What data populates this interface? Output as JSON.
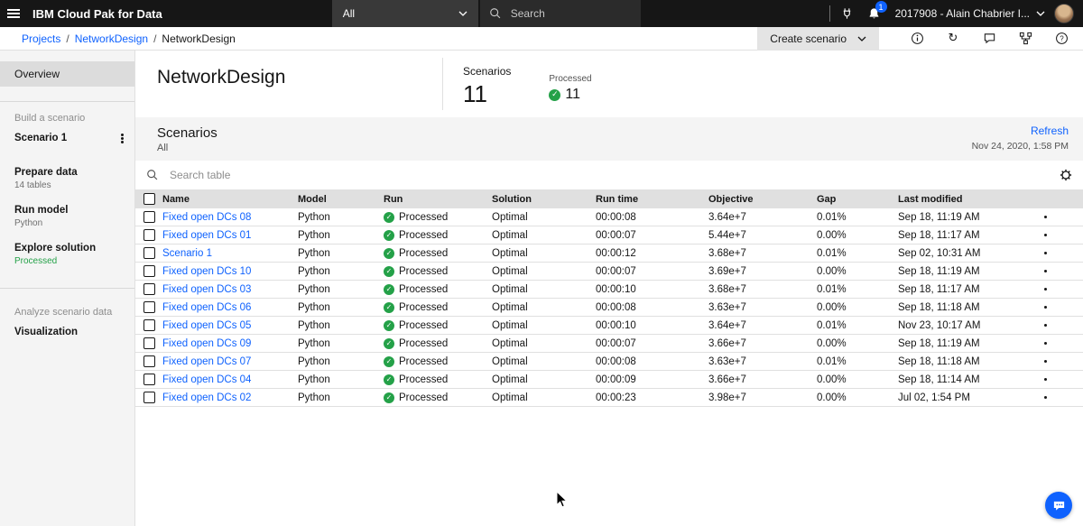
{
  "topbar": {
    "product_title": "IBM Cloud Pak for Data",
    "scope_dropdown": "All",
    "search_placeholder": "Search",
    "notification_badge": "1",
    "account_label": "2017908 - Alain Chabrier I..."
  },
  "breadcrumb": {
    "items": [
      "Projects",
      "NetworkDesign",
      "NetworkDesign"
    ],
    "separator": "/"
  },
  "actions": {
    "create_scenario": "Create scenario"
  },
  "sidebar": {
    "overview": "Overview",
    "build_label": "Build a scenario",
    "scenario": {
      "title": "Scenario 1"
    },
    "prepare": {
      "title": "Prepare data",
      "subtitle": "14 tables"
    },
    "run": {
      "title": "Run model",
      "subtitle": "Python"
    },
    "explore": {
      "title": "Explore solution",
      "subtitle": "Processed"
    },
    "analyze_label": "Analyze scenario data",
    "visualization": "Visualization"
  },
  "header": {
    "title": "NetworkDesign",
    "scenarios_label": "Scenarios",
    "scenarios_count": "11",
    "processed_label": "Processed",
    "processed_count": "11"
  },
  "band": {
    "title": "Scenarios",
    "filter": "All",
    "refresh": "Refresh",
    "timestamp": "Nov 24, 2020, 1:58 PM"
  },
  "table": {
    "search_placeholder": "Search table",
    "columns": [
      "Name",
      "Model",
      "Run",
      "Solution",
      "Run time",
      "Objective",
      "Gap",
      "Last modified"
    ],
    "rows": [
      {
        "name": "Fixed open DCs 08",
        "model": "Python",
        "run": "Processed",
        "solution": "Optimal",
        "run_time": "00:00:08",
        "objective": "3.64e+7",
        "gap": "0.01%",
        "last_modified": "Sep 18, 11:19 AM"
      },
      {
        "name": "Fixed open DCs 01",
        "model": "Python",
        "run": "Processed",
        "solution": "Optimal",
        "run_time": "00:00:07",
        "objective": "5.44e+7",
        "gap": "0.00%",
        "last_modified": "Sep 18, 11:17 AM"
      },
      {
        "name": "Scenario 1",
        "model": "Python",
        "run": "Processed",
        "solution": "Optimal",
        "run_time": "00:00:12",
        "objective": "3.68e+7",
        "gap": "0.01%",
        "last_modified": "Sep 02, 10:31 AM"
      },
      {
        "name": "Fixed open DCs 10",
        "model": "Python",
        "run": "Processed",
        "solution": "Optimal",
        "run_time": "00:00:07",
        "objective": "3.69e+7",
        "gap": "0.00%",
        "last_modified": "Sep 18, 11:19 AM"
      },
      {
        "name": "Fixed open DCs 03",
        "model": "Python",
        "run": "Processed",
        "solution": "Optimal",
        "run_time": "00:00:10",
        "objective": "3.68e+7",
        "gap": "0.01%",
        "last_modified": "Sep 18, 11:17 AM"
      },
      {
        "name": "Fixed open DCs 06",
        "model": "Python",
        "run": "Processed",
        "solution": "Optimal",
        "run_time": "00:00:08",
        "objective": "3.63e+7",
        "gap": "0.00%",
        "last_modified": "Sep 18, 11:18 AM"
      },
      {
        "name": "Fixed open DCs 05",
        "model": "Python",
        "run": "Processed",
        "solution": "Optimal",
        "run_time": "00:00:10",
        "objective": "3.64e+7",
        "gap": "0.01%",
        "last_modified": "Nov 23, 10:17 AM"
      },
      {
        "name": "Fixed open DCs 09",
        "model": "Python",
        "run": "Processed",
        "solution": "Optimal",
        "run_time": "00:00:07",
        "objective": "3.66e+7",
        "gap": "0.00%",
        "last_modified": "Sep 18, 11:19 AM"
      },
      {
        "name": "Fixed open DCs 07",
        "model": "Python",
        "run": "Processed",
        "solution": "Optimal",
        "run_time": "00:00:08",
        "objective": "3.63e+7",
        "gap": "0.01%",
        "last_modified": "Sep 18, 11:18 AM"
      },
      {
        "name": "Fixed open DCs 04",
        "model": "Python",
        "run": "Processed",
        "solution": "Optimal",
        "run_time": "00:00:09",
        "objective": "3.66e+7",
        "gap": "0.00%",
        "last_modified": "Sep 18, 11:14 AM"
      },
      {
        "name": "Fixed open DCs 02",
        "model": "Python",
        "run": "Processed",
        "solution": "Optimal",
        "run_time": "00:00:23",
        "objective": "3.98e+7",
        "gap": "0.00%",
        "last_modified": "Jul 02, 1:54 PM"
      }
    ]
  },
  "icons": {
    "check": "✓",
    "help": "?",
    "history": "↻"
  },
  "colors": {
    "link": "#0f62fe",
    "success": "#24a148",
    "topbar": "#161616"
  }
}
